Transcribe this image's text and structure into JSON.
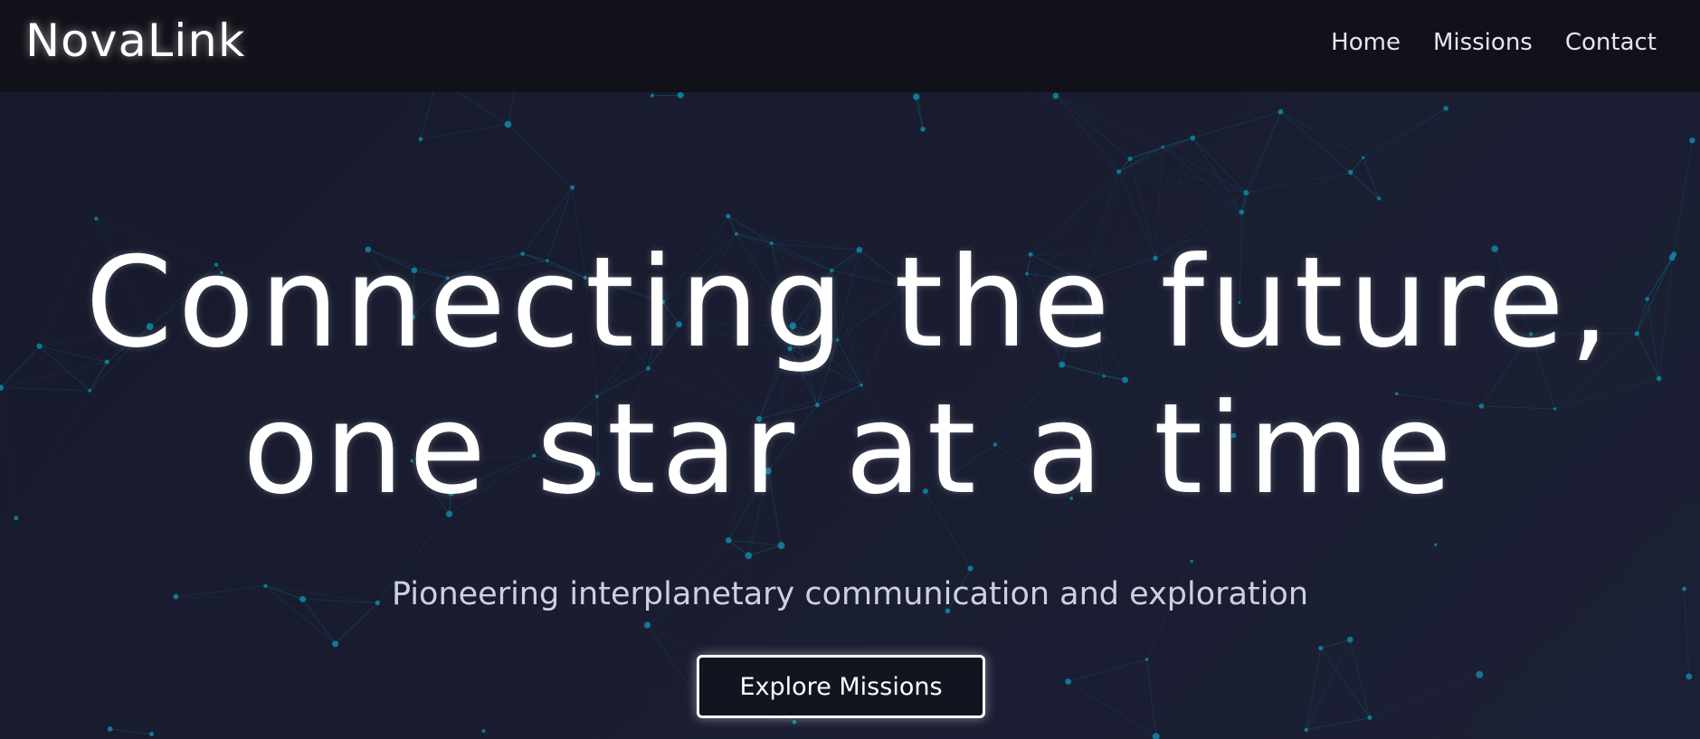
{
  "brand": {
    "name": "NovaLink"
  },
  "nav": {
    "items": [
      {
        "label": "Home"
      },
      {
        "label": "Missions"
      },
      {
        "label": "Contact"
      }
    ]
  },
  "hero": {
    "headline_line1": "Connecting the future,",
    "headline_line2": "one star at a time",
    "subtitle": "Pioneering interplanetary communication and exploration",
    "cta_label": "Explore Missions"
  },
  "colors": {
    "background": "#191c2e",
    "navbar": "#101119",
    "network_node": "#0e8fae",
    "network_line": "#0f6a86",
    "text": "#ffffff",
    "subtitle": "#cfd0de"
  }
}
